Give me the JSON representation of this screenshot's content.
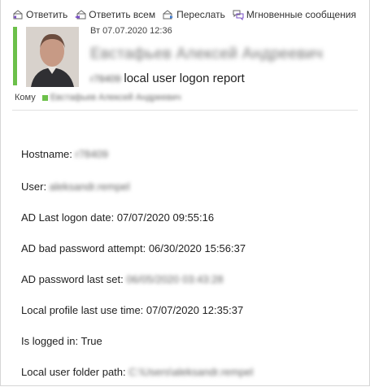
{
  "toolbar": {
    "reply": "Ответить",
    "reply_all": "Ответить всем",
    "forward": "Переслать",
    "im": "Мгновенные сообщения"
  },
  "message": {
    "date": "Вт 07.07.2020 12:36",
    "sender": "Евстафьев Алексей Андреевич",
    "subject_host": "r78409",
    "subject": "local user logon report",
    "to_label": "Кому",
    "to_name": "Евстафьев Алексей Андреевич"
  },
  "report": [
    {
      "label": "Hostname: ",
      "value": "r78409",
      "blurred": true
    },
    {
      "label": "User: ",
      "value": "aleksandr.rempel",
      "blurred": true
    },
    {
      "label": "AD Last logon date: ",
      "value": "07/07/2020 09:55:16",
      "blurred": false
    },
    {
      "label": "AD bad password attempt: ",
      "value": "06/30/2020 15:56:37",
      "blurred": false
    },
    {
      "label": "AD password last set: ",
      "value": "06/05/2020 03:43:28",
      "blurred": true
    },
    {
      "label": "Local profile last use time: ",
      "value": "07/07/2020 12:35:37",
      "blurred": false
    },
    {
      "label": "Is logged in: ",
      "value": "True",
      "blurred": false
    },
    {
      "label": "Local user folder path: ",
      "value": "C:\\Users\\aleksandr.rempel",
      "blurred": true
    }
  ],
  "colors": {
    "presence": "#6cc04a",
    "accent": "#5b5fc7"
  }
}
